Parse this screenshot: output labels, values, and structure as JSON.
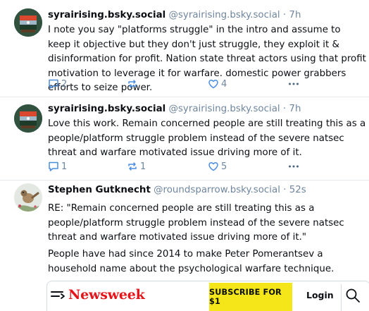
{
  "posts": [
    {
      "display_name": "syrairising.bsky.social",
      "handle": "@syrairising.bsky.social",
      "separator": "·",
      "time": "7h",
      "text": "I note you say \"platforms struggle\" in the intro and assume to keep it objective but they don't just struggle, they exploit it & disinformation for profit. Nation state threat actors using that profit motivation to leverage it for warfare. domestic power grabbers efforts to seize power.",
      "reply_count": "2",
      "repost_count": "",
      "like_count": "4"
    },
    {
      "display_name": "syrairising.bsky.social",
      "handle": "@syrairising.bsky.social",
      "separator": "·",
      "time": "7h",
      "text": "Love this work.  Remain concerned people are still treating this as a people/platform struggle problem instead of the severe natsec threat and warfare motivated issue driving more of it.",
      "reply_count": "1",
      "repost_count": "1",
      "like_count": "5"
    },
    {
      "display_name": "Stephen Gutknecht",
      "handle": "@roundsparrow.bsky.social",
      "separator": "·",
      "time": "52s",
      "text_p1": "RE: \"Remain concerned people are still treating this as a people/platform struggle problem instead of the severe natsec threat and warfare motivated issue driving more of it.\"",
      "text_p2": "People have had since 2014 to make Peter Pomerantsev a household name about the psychological warfare technique."
    }
  ],
  "embed": {
    "logo_text": "Newsweek",
    "subscribe_label": "SUBSCRIBE FOR $1",
    "login_label": "Login",
    "icons": [
      "menu-icon",
      "search-icon"
    ],
    "colors": {
      "logo": "#e4161b",
      "subscribe_bg": "#f5e61a"
    }
  },
  "colors": {
    "muted": "#6f869f",
    "text": "#0b0f14",
    "divider": "#e6ebf0"
  }
}
